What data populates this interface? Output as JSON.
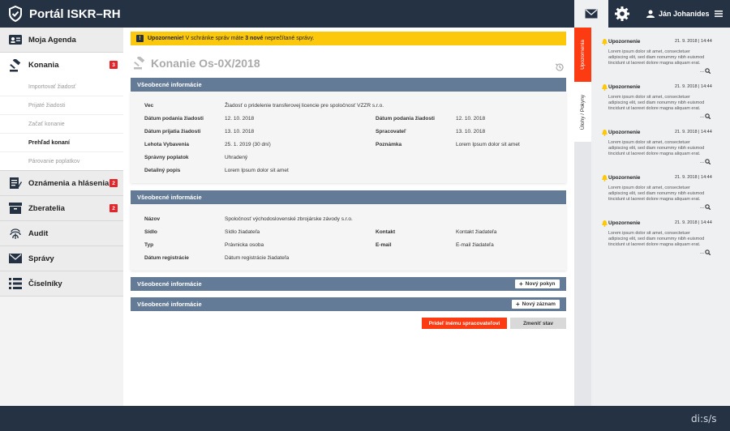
{
  "header": {
    "app_title": "Portál ISKR–RH",
    "user_name": "Ján Johanides"
  },
  "sidebar": {
    "items": [
      {
        "label": "Moja Agenda",
        "icon": "id-card-icon",
        "badge": ""
      },
      {
        "label": "Konania",
        "icon": "gavel-icon",
        "badge": "3"
      },
      {
        "label": "Oznámenia a hlásenia",
        "icon": "document-edit-icon",
        "badge": "2"
      },
      {
        "label": "Zberatelia",
        "icon": "archive-icon",
        "badge": "2"
      },
      {
        "label": "Audit",
        "icon": "fingerprint-icon",
        "badge": ""
      },
      {
        "label": "Správy",
        "icon": "envelope-icon",
        "badge": ""
      },
      {
        "label": "Číselníky",
        "icon": "list-icon",
        "badge": ""
      }
    ],
    "subitems": [
      {
        "label": "Importovať žiadosť"
      },
      {
        "label": "Prijaté žiadosti"
      },
      {
        "label": "Začať konanie"
      },
      {
        "label": "Prehľad konaní"
      },
      {
        "label": "Párovanie poplatkov"
      }
    ]
  },
  "alert": {
    "strong": "Upozornenie!",
    "text1": " V schránke správ máte ",
    "count": "3 nové",
    "text2": " neprečítané správy.",
    "icon": "exclamation-icon"
  },
  "page": {
    "title": "Konanie Os-0X/2018",
    "history_icon": "history-icon"
  },
  "panel1": {
    "title": "Všeobecné informácie",
    "vec_label": "Vec",
    "vec_value": "Žiadosť o pridelenie transferovej licencie pre spoločnosť VZZR s.r.o.",
    "datum_podania_label": "Dátum podania žiadosti",
    "datum_podania_value": "12. 10. 2018",
    "datum_podania2_label": "Dátum podania žiadosti",
    "datum_podania2_value": "12. 10. 2018",
    "datum_prijatia_label": "Dátum prijatia žiadosti",
    "datum_prijatia_value": "13. 10. 2018",
    "spracovatel_label": "Spracovateľ",
    "spracovatel_value": "13. 10. 2018",
    "lehota_label": "Lehota Vybavenia",
    "lehota_value": "25. 1. 2019 (30 dní)",
    "poznamka_label": "Poznámka",
    "poznamka_value": "Lorem Ipsum dolor sit amet",
    "poplatok_label": "Správny poplatok",
    "poplatok_value": "Uhradený",
    "popis_label": "Detailný popis",
    "popis_value": "Lorem Ipsum dolor sit amet"
  },
  "panel2": {
    "title": "Všeobecné informácie",
    "nazov_label": "Názov",
    "nazov_value": "Spoločnosť východoslovenské zbrojárske závody s.r.o.",
    "sidlo_label": "Sídlo",
    "sidlo_value": "Sídlo žiadateľa",
    "kontakt_label": "Kontakt",
    "kontakt_value": "Kontakt žiadateľa",
    "typ_label": "Typ",
    "typ_value": "Právnicka osoba",
    "email_label": "E-mail",
    "email_value": "E-mail žiadateľa",
    "reg_label": "Dátum registrácie",
    "reg_value": "Dátum registrácie žiadateľa"
  },
  "panel3": {
    "title": "Všeobecné informácie",
    "button": "Nový pokyn"
  },
  "panel4": {
    "title": "Všeobecné informácie",
    "button": "Nový záznam"
  },
  "actions": {
    "assign": "Prideľ inému spracovateľovi",
    "change_state": "Zmeniť stav"
  },
  "right_tabs": {
    "upozornenia": "Upozornenia",
    "ulohy": "Úlohy / Pokyny"
  },
  "notifications": [
    {
      "title": "Upozornenie",
      "date": "21. 9. 2018 | 14:44",
      "body": "Lorem ipsum dolor sit amet, consectetuer adipiscing elit, sed diam nonummy nibh euismod tincidunt ut laoreet dolore magna aliquam erat.",
      "more": "..."
    },
    {
      "title": "Upozornenie",
      "date": "21. 9. 2018 | 14:44",
      "body": "Lorem ipsum dolor sit amet, consectetuer adipiscing elit, sed diam nonummy nibh euismod tincidunt ut laoreet dolore magna aliquam erat.",
      "more": "..."
    },
    {
      "title": "Upozornenie",
      "date": "21. 9. 2018 | 14:44",
      "body": "Lorem ipsum dolor sit amet, consectetuer adipiscing elit, sed diam nonummy nibh euismod tincidunt ut laoreet dolore magna aliquam erat.",
      "more": "..."
    },
    {
      "title": "Upozornenie",
      "date": "21. 9. 2018 | 14:44",
      "body": "Lorem ipsum dolor sit amet, consectetuer adipiscing elit, sed diam nonummy nibh euismod tincidunt ut laoreet dolore magna aliquam erat.",
      "more": "..."
    },
    {
      "title": "Upozornenie",
      "date": "21. 9. 2018 | 14:44",
      "body": "Lorem ipsum dolor sit amet, consectetuer adipiscing elit, sed diam nonummy nibh euismod tincidunt ut laoreet dolore magna aliquam erat.",
      "more": "..."
    }
  ],
  "footer": {
    "logo": "di:s/s"
  },
  "colors": {
    "navy": "#253244",
    "accent": "#fc3b12",
    "panel": "#637b96",
    "alert": "#fcc80b",
    "badge": "#e3262c"
  }
}
